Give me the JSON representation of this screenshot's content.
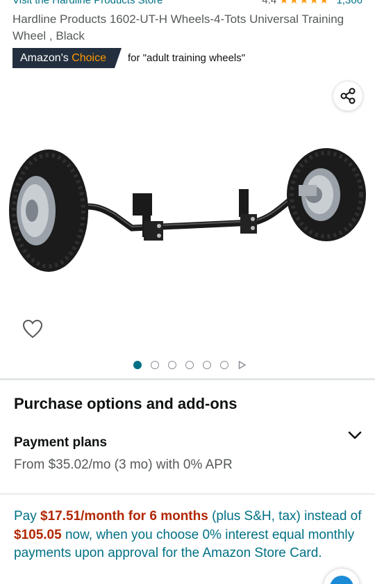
{
  "store": {
    "link_text": "Visit the Hardline Products Store",
    "rating_value": "4.4",
    "stars": "★★★★★",
    "review_count": "1,366"
  },
  "product": {
    "title": "Hardline Products 1602-UT-H Wheels-4-Tots Universal Training Wheel , Black",
    "image_icon": "training-wheels-product-photo"
  },
  "badge": {
    "prefix": "Amazon's",
    "choice": "Choice",
    "for_text": "for \"adult training wheels\""
  },
  "actions": {
    "share_icon": "share-icon",
    "wishlist_icon": "heart-icon"
  },
  "carousel": {
    "total_dots": 6,
    "active_index": 0,
    "next_icon": "play-triangle-icon"
  },
  "purchase": {
    "heading": "Purchase options and add-ons",
    "payment_plans_label": "Payment plans",
    "payment_plans_sub": "From $35.02/mo (3 mo) with 0% APR"
  },
  "card_offer": {
    "pay": "Pay",
    "monthly": "$17.51/month for 6 months",
    "plus_text": "(plus S&H, tax) instead of",
    "total": "$105.05",
    "rest": "now, when you choose 0% interest equal monthly payments upon approval for the Amazon Store Card."
  },
  "colors": {
    "link": "#007185",
    "price": "#b12704",
    "badge_bg": "#232f3e",
    "badge_accent": "#ff9900",
    "star": "#ff9900"
  }
}
